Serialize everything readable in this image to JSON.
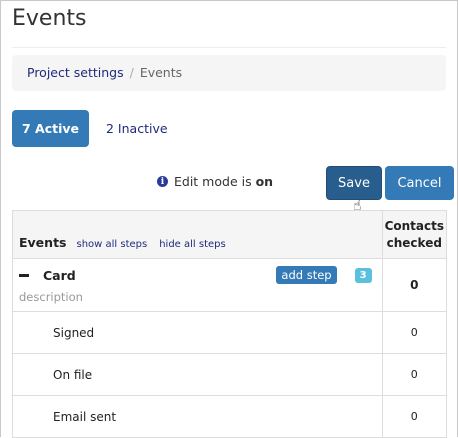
{
  "page_title": "Events",
  "breadcrumb": {
    "parent": "Project settings",
    "separator": "/",
    "current": "Events"
  },
  "tabs": {
    "active": "7 Active",
    "inactive": "2 Inactive"
  },
  "edit_mode": {
    "prefix": "Edit mode is",
    "state": "on"
  },
  "buttons": {
    "save": "Save",
    "cancel": "Cancel"
  },
  "table": {
    "header": {
      "events": "Events",
      "show_all": "show all steps",
      "hide_all": "hide all steps",
      "contacts": "Contacts checked"
    },
    "event": {
      "name": "Card",
      "description": "description",
      "add_step": "add step",
      "step_count": "3",
      "contacts": "0"
    },
    "steps": [
      {
        "name": "Signed",
        "contacts": "0"
      },
      {
        "name": "On file",
        "contacts": "0"
      },
      {
        "name": "Email sent",
        "contacts": "0"
      }
    ]
  }
}
